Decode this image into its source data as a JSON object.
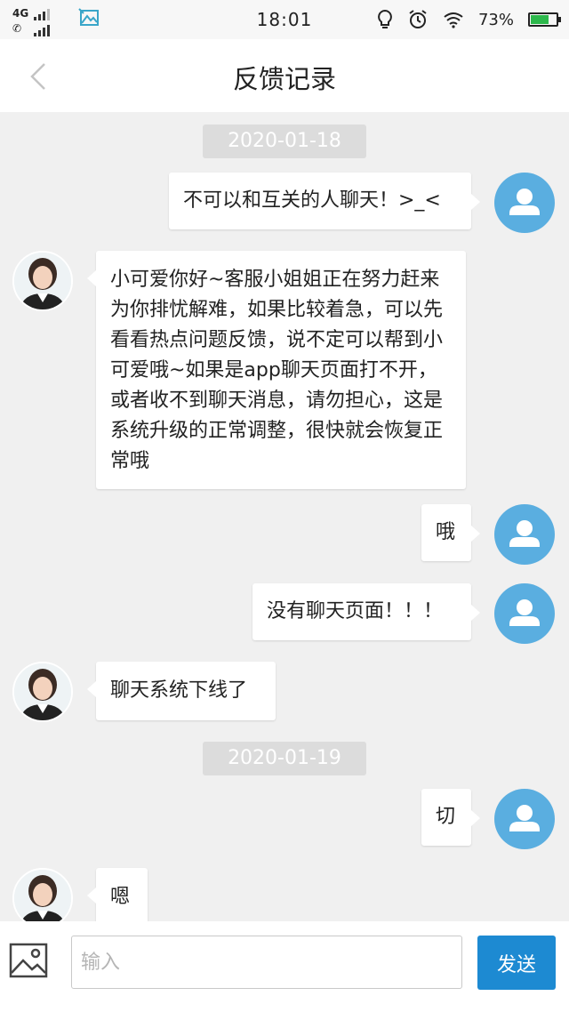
{
  "status_bar": {
    "network": "4G",
    "time": "18:01",
    "battery_percent": "73%",
    "battery_level": 0.73,
    "icons": [
      "signal-icon",
      "call-signal-icon",
      "gallery-icon",
      "bulb-icon",
      "alarm-icon",
      "wifi-icon",
      "battery-icon"
    ]
  },
  "header": {
    "title": "反馈记录",
    "back_icon": "chevron-left-icon"
  },
  "chat": {
    "date1": "2020-01-18",
    "date2": "2020-01-19",
    "messages": [
      {
        "from": "user",
        "text": "不可以和互关的人聊天！>_<"
      },
      {
        "from": "agent",
        "text": "小可爱你好~客服小姐姐正在努力赶来为你排忧解难，如果比较着急，可以先看看热点问题反馈，说不定可以帮到小可爱哦~如果是app聊天页面打不开，或者收不到聊天消息，请勿担心，这是系统升级的正常调整，很快就会恢复正常哦"
      },
      {
        "from": "user",
        "text": "哦"
      },
      {
        "from": "user",
        "text": "没有聊天页面！！！"
      },
      {
        "from": "agent",
        "text": "聊天系统下线了"
      },
      {
        "from": "user",
        "text": "切"
      },
      {
        "from": "agent",
        "text": "嗯"
      }
    ]
  },
  "input_bar": {
    "image_icon": "image-icon",
    "placeholder": "输入",
    "value": "",
    "send_label": "发送"
  },
  "colors": {
    "accent": "#1d8ad2",
    "user_avatar": "#5aaee0",
    "chat_background": "#f0f0f0",
    "bubble": "#ffffff"
  }
}
